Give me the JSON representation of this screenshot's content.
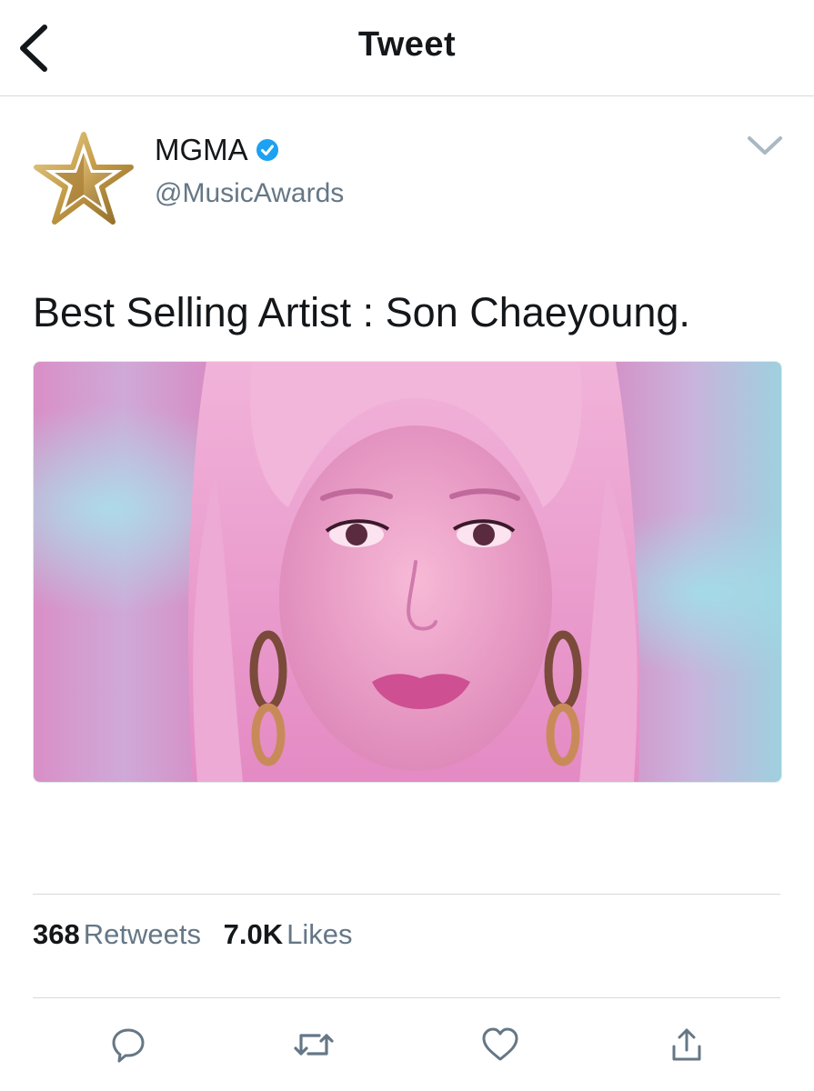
{
  "header": {
    "title": "Tweet",
    "back_icon": "chevron-left-icon"
  },
  "author": {
    "display_name": "MGMA",
    "handle": "@MusicAwards",
    "verified": true,
    "avatar_icon": "gold-star-logo"
  },
  "tweet": {
    "text": "Best Selling Artist : Son Chaeyoung.",
    "media": "photo"
  },
  "stats": {
    "retweets_count": "368",
    "retweets_label": "Retweets",
    "likes_count": "7.0K",
    "likes_label": "Likes"
  },
  "actions": [
    "reply-icon",
    "retweet-icon",
    "like-icon",
    "share-icon"
  ],
  "colors": {
    "text": "#14171a",
    "secondary_text": "#657786",
    "divider": "#d9d9d9",
    "verified_blue": "#1da1f2",
    "icon_gray": "#657786",
    "gold": "#c9a95a"
  }
}
